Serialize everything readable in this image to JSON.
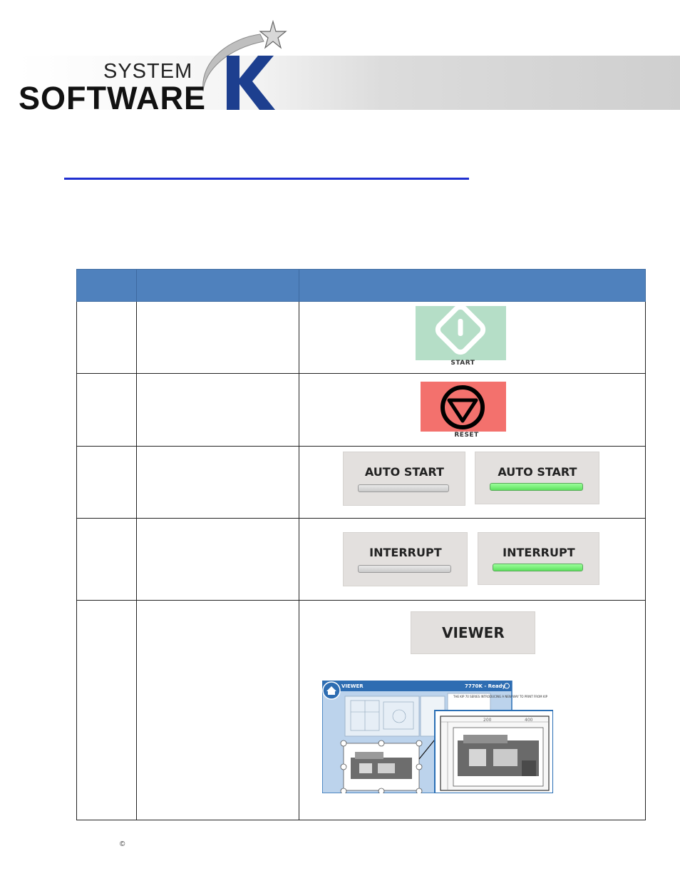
{
  "logo": {
    "line1": "SYSTEM",
    "line2": "SOFTWARE",
    "letter": "K"
  },
  "table": {
    "rows": [
      {
        "button_label": "START",
        "accent": "#b5dec7"
      },
      {
        "button_label": "RESET",
        "accent": "#f3716d"
      },
      {
        "off_label": "AUTO START",
        "on_label": "AUTO START"
      },
      {
        "off_label": "INTERRUPT",
        "on_label": "INTERRUPT"
      },
      {
        "button_label": "VIEWER",
        "screenshot": {
          "title": "VIEWER",
          "status": "7770K - Ready",
          "ruler_marks": [
            "200",
            "400"
          ],
          "doc_text": "THE KIP 70 SERIES INTRODUCING A NEW WAY TO PRINT FROM KIP"
        }
      }
    ]
  },
  "footer": {
    "copyright_symbol": "©"
  },
  "colors": {
    "header_blue": "#4f81bd",
    "title_rule": "#1f2fd0",
    "toggle_on": "#6ee86e"
  }
}
